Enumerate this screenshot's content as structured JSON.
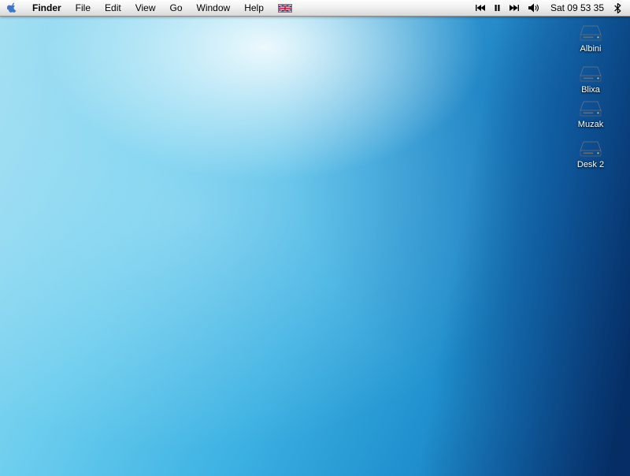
{
  "menubar": {
    "menus": [
      {
        "label": "Finder"
      },
      {
        "label": "File"
      },
      {
        "label": "Edit"
      },
      {
        "label": "View"
      },
      {
        "label": "Go"
      },
      {
        "label": "Window"
      },
      {
        "label": "Help"
      }
    ],
    "icons": {
      "apple": "apple-logo-icon",
      "input_flag": "uk-flag-icon",
      "media": [
        "rewind-icon",
        "pause-icon",
        "fast-forward-icon"
      ],
      "volume": "speaker-icon",
      "bluetooth": "bluetooth-icon"
    },
    "clock": "Sat 09 53 35"
  },
  "desktop": {
    "icons": [
      {
        "label": "Albini",
        "icon": "hard-drive-icon"
      },
      {
        "label": "Blixa",
        "icon": "hard-drive-icon"
      },
      {
        "label": "Muzak",
        "icon": "hard-drive-icon"
      },
      {
        "label": "Desk 2",
        "icon": "hard-drive-icon"
      }
    ]
  },
  "colors": {
    "menubar_top": "#fefefe",
    "menubar_bottom": "#d8d8d8",
    "wallpaper_light": "#a5e0f3",
    "wallpaper_mid": "#2fa2da",
    "wallpaper_dark": "#0b4f9e",
    "icon_label_text": "#ffffff"
  }
}
